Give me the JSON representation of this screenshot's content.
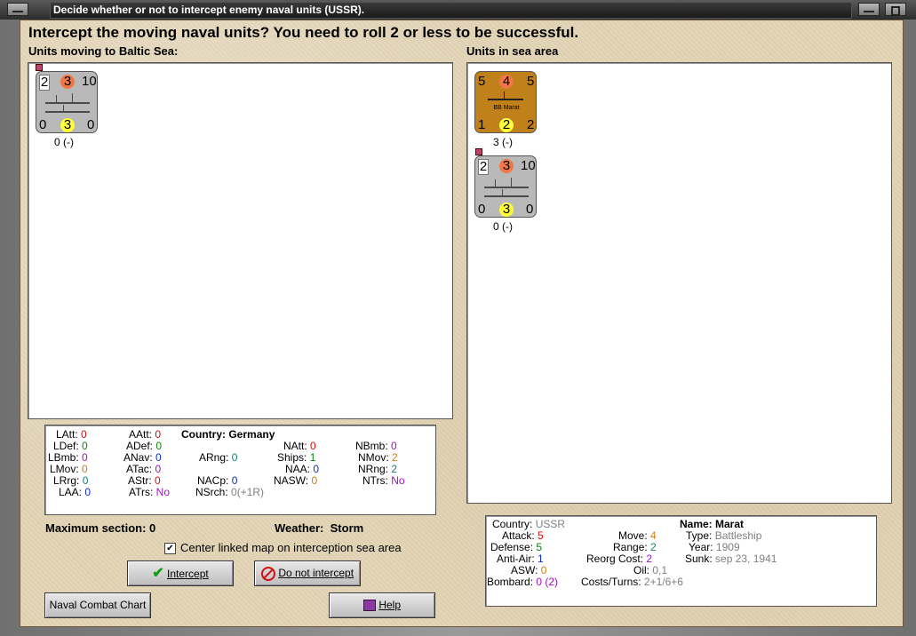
{
  "window": {
    "title": "Decide whether or not to intercept enemy naval units (USSR)."
  },
  "heading": "Intercept the moving naval units?  You need to roll 2 or less to be successful.",
  "left_panel": {
    "label": "Units moving to Baltic Sea:",
    "unit": {
      "tl": "2",
      "tc": "3",
      "tr": "10",
      "bl": "0",
      "bc": "3",
      "br": "0",
      "caption": "0 (-)"
    }
  },
  "right_panel": {
    "label": "Units in sea area",
    "unit1": {
      "tl": "5",
      "tc": "4",
      "tr": "5",
      "name": "BB Marat",
      "bl": "1",
      "bc": "2",
      "br": "2",
      "caption": "3 (-)"
    },
    "unit2": {
      "tl": "2",
      "tc": "3",
      "tr": "10",
      "bl": "0",
      "bc": "3",
      "br": "0",
      "caption": "0 (-)"
    }
  },
  "german_stats": {
    "country_label": "Country:",
    "country": "Germany",
    "LAtt": "0",
    "LDef": "0",
    "LBmb": "0",
    "LMov": "0",
    "LRrg": "0",
    "LAA": "0",
    "AAtt": "0",
    "ADef": "0",
    "ANav": "0",
    "ATac": "0",
    "AStr": "0",
    "ATrs": "No",
    "ARng": "0",
    "NACp": "0",
    "NSrch": "0(+1R)",
    "NAtt": "0",
    "Ships": "1",
    "NAA": "0",
    "NASW": "0",
    "NBmb": "0",
    "NMov": "2",
    "NRng": "2",
    "NTrs": "No"
  },
  "footer": {
    "max_section_label": "Maximum section:",
    "max_section": "0",
    "weather_label": "Weather:",
    "weather": "Storm",
    "center_label": "Center linked map on interception sea area"
  },
  "buttons": {
    "intercept": "Intercept",
    "no_intercept": "Do not intercept",
    "chart": "Naval Combat Chart",
    "help": "Help"
  },
  "unit_info": {
    "country": "USSR",
    "attack": "5",
    "defense": "5",
    "anti_air": "1",
    "asw": "0",
    "bombard": "0",
    "bombard_extra": "(2)",
    "name": "Marat",
    "move": "4",
    "range": "2",
    "reorg": "2",
    "oil": "0,1",
    "costs": "2+1/6+6",
    "type": "Battleship",
    "year": "1909",
    "sunk": "sep 23, 1941"
  },
  "colors": {
    "parchment": "#e2d4b6",
    "counter_gray": "#b9b9b9",
    "counter_brown": "#c0801a"
  }
}
